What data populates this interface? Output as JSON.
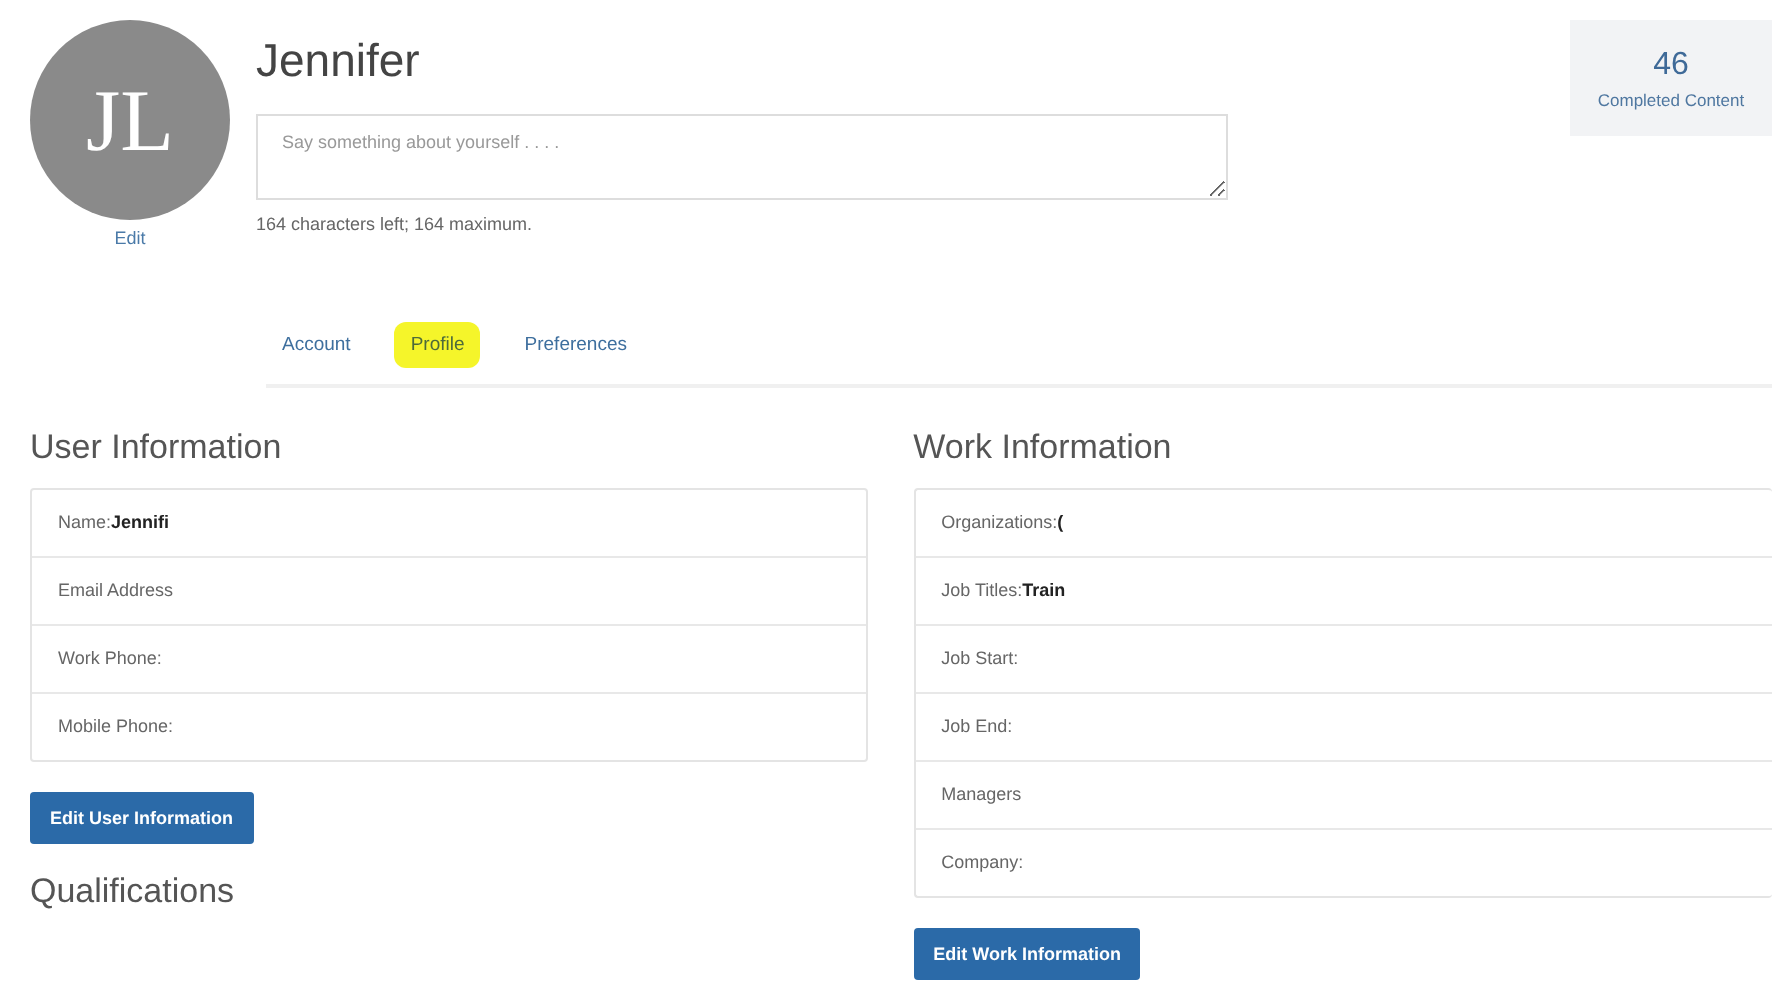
{
  "profile": {
    "initials": "JL",
    "edit_link": "Edit",
    "name": "Jennifer",
    "about": {
      "placeholder": "Say something about yourself . . . ."
    },
    "chars_hint": "164 characters left; 164 maximum."
  },
  "stat": {
    "value": "46",
    "label": "Completed Content"
  },
  "tabs": [
    {
      "label": "Account",
      "selected": false
    },
    {
      "label": "Profile",
      "selected": true
    },
    {
      "label": "Preferences",
      "selected": false
    }
  ],
  "user_information": {
    "title": "User Information",
    "rows": [
      {
        "label": "Name:",
        "value": "Jennifi"
      },
      {
        "label": "Email Address"
      },
      {
        "label": "Work Phone:"
      },
      {
        "label": "Mobile Phone:"
      }
    ],
    "button": "Edit User Information"
  },
  "qualifications": {
    "title": "Qualifications"
  },
  "work_information": {
    "title": "Work Information",
    "rows": [
      {
        "label": "Organizations:",
        "value": "("
      },
      {
        "label": "Job Titles:",
        "value": "Train"
      },
      {
        "label": "Job Start:"
      },
      {
        "label": "Job End:"
      },
      {
        "label": "Managers"
      },
      {
        "label": "Company:"
      }
    ],
    "button": "Edit Work Information"
  }
}
